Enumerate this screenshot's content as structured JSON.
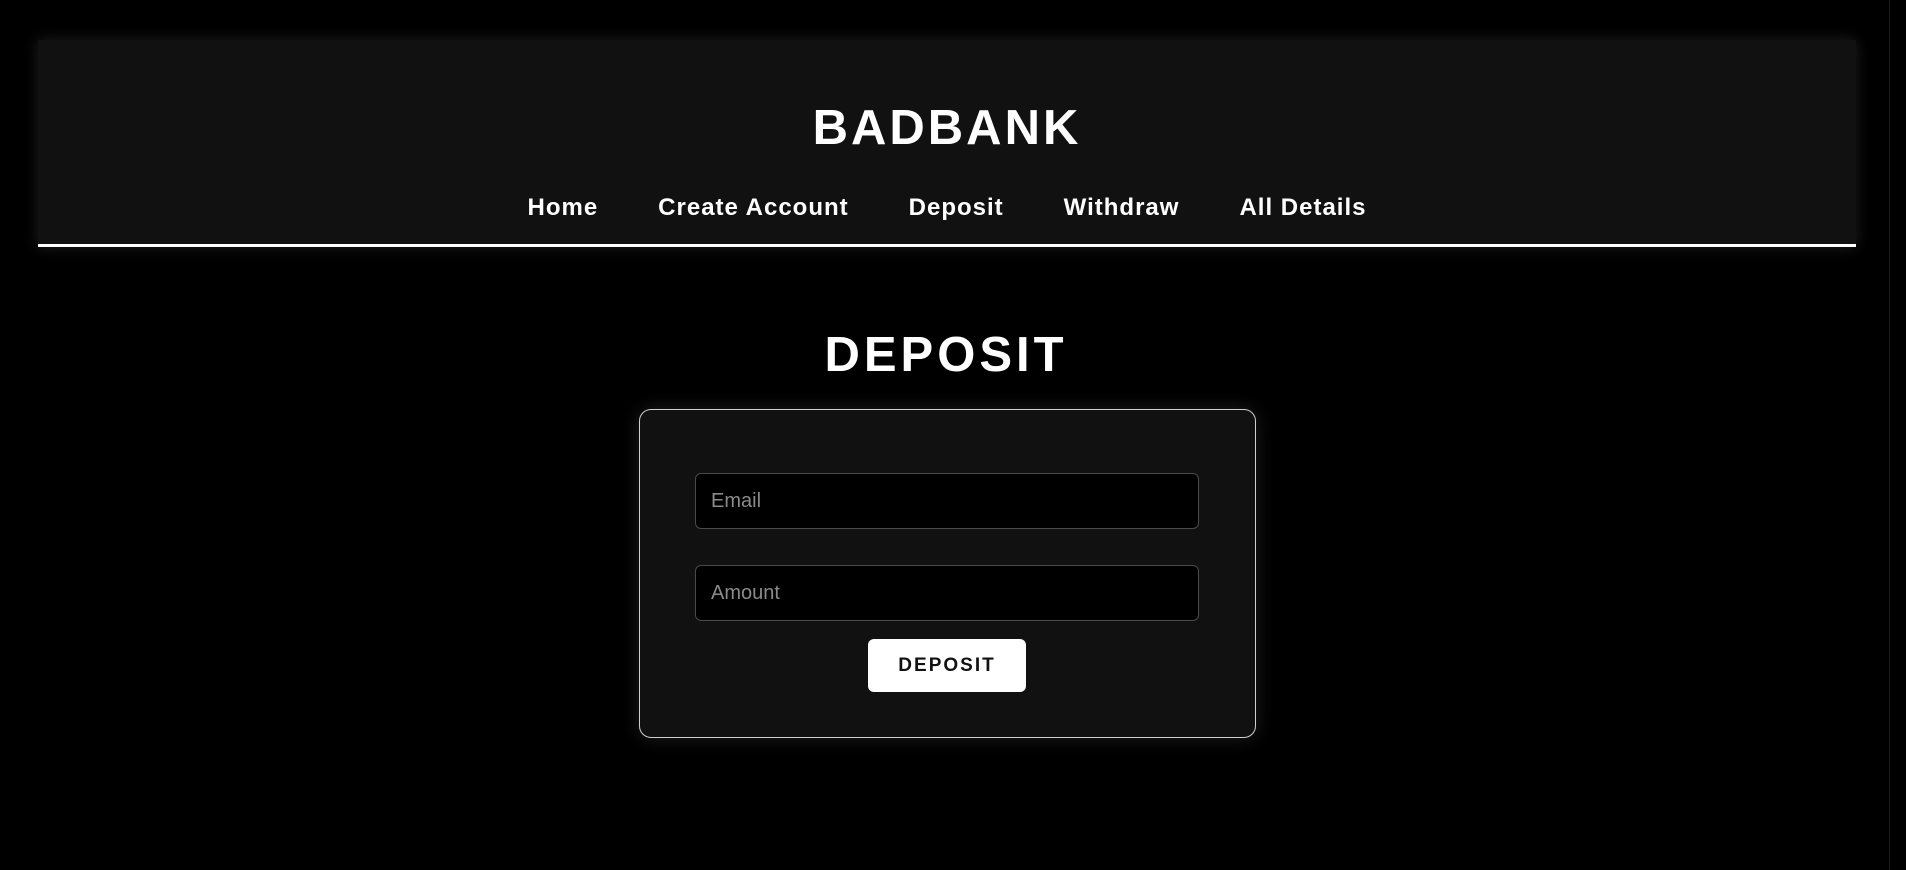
{
  "header": {
    "brand": "BADBANK",
    "nav": [
      "Home",
      "Create Account",
      "Deposit",
      "Withdraw",
      "All Details"
    ]
  },
  "page": {
    "title": "DEPOSIT"
  },
  "form": {
    "email_placeholder": "Email",
    "email_value": "",
    "amount_placeholder": "Amount",
    "amount_value": "",
    "submit_label": "DEPOSIT"
  },
  "colors": {
    "background": "#000000",
    "header_bg": "#111111",
    "card_bg": "#111111",
    "accent": "#ffffff"
  }
}
